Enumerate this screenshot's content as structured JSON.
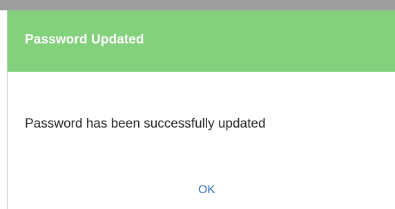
{
  "dialog": {
    "title": "Password Updated",
    "message": "Password has been successfully updated",
    "ok_label": "OK"
  },
  "colors": {
    "header_bg": "#83d17c",
    "title_text": "#ffffff",
    "button_text": "#2e6fb4",
    "top_strip": "#9e9e9e"
  }
}
